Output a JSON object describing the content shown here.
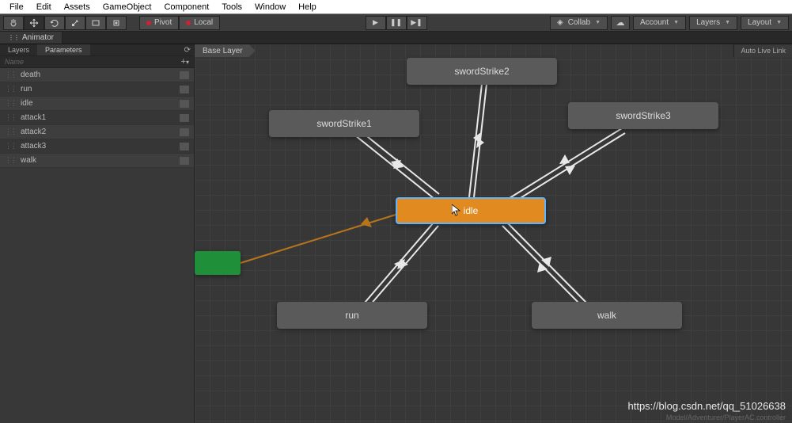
{
  "menu": {
    "items": [
      "File",
      "Edit",
      "Assets",
      "GameObject",
      "Component",
      "Tools",
      "Window",
      "Help"
    ]
  },
  "toolbar": {
    "pivot": "Pivot",
    "local": "Local",
    "collab": "Collab",
    "account": "Account",
    "layers": "Layers",
    "layout": "Layout"
  },
  "tab": {
    "title": "Animator"
  },
  "sidebar": {
    "tabs": {
      "layers": "Layers",
      "parameters": "Parameters"
    },
    "name_placeholder": "Name",
    "params": [
      {
        "name": "death"
      },
      {
        "name": "run"
      },
      {
        "name": "idle"
      },
      {
        "name": "attack1"
      },
      {
        "name": "attack2"
      },
      {
        "name": "attack3"
      },
      {
        "name": "walk"
      }
    ]
  },
  "canvas": {
    "breadcrumb": "Base Layer",
    "auto_live": "Auto Live Link",
    "nodes": {
      "swordStrike1": "swordStrike1",
      "swordStrike2": "swordStrike2",
      "swordStrike3": "swordStrike3",
      "idle": "idle",
      "run": "run",
      "walk": "walk"
    },
    "footer": "Model/Adventurer/PlayerAC.controller"
  },
  "watermark": "https://blog.csdn.net/qq_51026638"
}
